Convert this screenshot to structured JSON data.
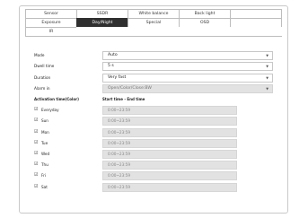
{
  "tabs": {
    "row1": [
      "Sensor",
      "SSDR",
      "White balance",
      "Back light",
      ""
    ],
    "row2": [
      "Exposure",
      "Day/Night",
      "Special",
      "OSD",
      ""
    ],
    "row3": [
      "IR"
    ]
  },
  "form": {
    "mode_label": "Mode",
    "mode_value": "Auto",
    "dwell_label": "Dwell time",
    "dwell_value": "5 s",
    "duration_label": "Duration",
    "duration_value": "Very fast",
    "alarm_label": "Alarm in",
    "alarm_value": "Open/Color/Close:BW",
    "activation_label": "Activation time(Color)",
    "start_end_label": "Start time - End time"
  },
  "days": [
    {
      "label": "Everyday",
      "time": "0:00~23:59"
    },
    {
      "label": "Sun",
      "time": "0:00~23:59"
    },
    {
      "label": "Mon",
      "time": "0:00~23:59"
    },
    {
      "label": "Tue",
      "time": "0:00~23:59"
    },
    {
      "label": "Wed",
      "time": "0:00~23:59"
    },
    {
      "label": "Thu",
      "time": "0:00~23:59"
    },
    {
      "label": "Fri",
      "time": "0:00~23:59"
    },
    {
      "label": "Sat",
      "time": "0:00~23:59"
    }
  ],
  "icons": {
    "checkbox": "☑",
    "caret": "▼"
  },
  "colors": {
    "active_tab": "#2f2f2f",
    "disabled_field": "#e2e2e2"
  }
}
